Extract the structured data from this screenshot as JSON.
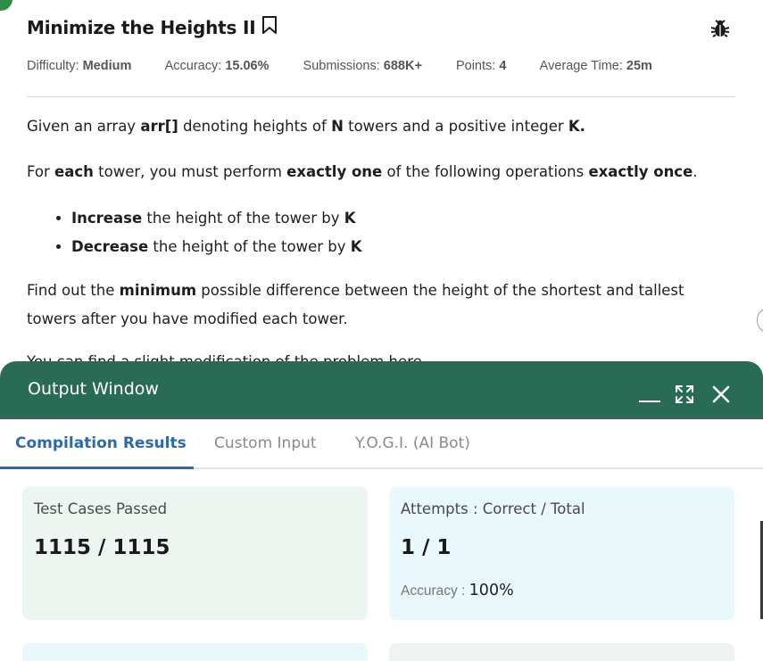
{
  "problem": {
    "title": "Minimize the Heights II",
    "meta": [
      {
        "label": "Difficulty:",
        "value": "Medium"
      },
      {
        "label": "Accuracy:",
        "value": "15.06%"
      },
      {
        "label": "Submissions:",
        "value": "688K+"
      },
      {
        "label": "Points:",
        "value": "4"
      },
      {
        "label": "Average Time:",
        "value": "25m"
      }
    ],
    "para1": {
      "t1": "Given an array ",
      "b1": "arr[]",
      "t2": " denoting heights of ",
      "b2": "N",
      "t3": " towers and a positive integer ",
      "b3": "K."
    },
    "para2": {
      "t1": "For ",
      "b1": "each",
      "t2": " tower, you must perform ",
      "b2": "exactly one",
      "t3": " of the following operations ",
      "b3": "exactly once",
      "t4": "."
    },
    "bullets": [
      {
        "b": "Increase",
        "t": " the height of the tower by ",
        "k": "K"
      },
      {
        "b": "Decrease",
        "t": " the height of the tower by ",
        "k": "K"
      }
    ],
    "para3": {
      "t1": "Find out the ",
      "b1": "minimum",
      "t2": " possible difference between the height of the shortest and tallest towers after you have modified each tower."
    },
    "cut_line": "You can find a slight modification of the problem here."
  },
  "output": {
    "title": "Output Window",
    "tabs": [
      "Compilation Results",
      "Custom Input",
      "Y.O.G.I. (AI Bot)"
    ],
    "active_tab": 0,
    "cards": {
      "tests": {
        "label": "Test Cases Passed",
        "value": "1115 / 1115"
      },
      "attempts": {
        "label": "Attempts : Correct / Total",
        "value": "1 / 1",
        "accuracy_label": "Accuracy :",
        "accuracy_value": "100%"
      }
    }
  },
  "colors": {
    "header_bg": "#2a6b56",
    "active_tab": "#2d6aa8",
    "card_green": "#edf5f1",
    "card_blue": "#e9f8fb",
    "corner_dot": "#2f8d46"
  }
}
